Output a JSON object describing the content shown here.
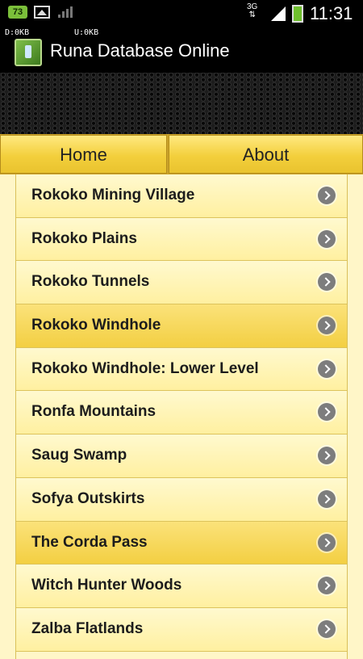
{
  "status_bar": {
    "notification_count": "73",
    "network_type": "3G",
    "time": "11:31",
    "icons": [
      "notification-badge-icon",
      "picture-icon",
      "wifi-bars-icon",
      "data-transfer-icon",
      "signal-icon",
      "battery-icon"
    ]
  },
  "app_bar": {
    "rx_label": "D:0KB",
    "tx_label": "U:0KB",
    "title": "Runa Database Online",
    "icon": "app-icon"
  },
  "nav": {
    "home_label": "Home",
    "about_label": "About"
  },
  "list": {
    "items": [
      {
        "label": "Rokoko Mining Village",
        "highlighted": false
      },
      {
        "label": "Rokoko Plains",
        "highlighted": false
      },
      {
        "label": "Rokoko Tunnels",
        "highlighted": false
      },
      {
        "label": "Rokoko Windhole",
        "highlighted": true
      },
      {
        "label": "Rokoko Windhole: Lower Level",
        "highlighted": false
      },
      {
        "label": "Ronfa Mountains",
        "highlighted": false
      },
      {
        "label": "Saug Swamp",
        "highlighted": false
      },
      {
        "label": "Sofya Outskirts",
        "highlighted": false
      },
      {
        "label": "The Corda Pass",
        "highlighted": true
      },
      {
        "label": "Witch Hunter Woods",
        "highlighted": false
      },
      {
        "label": "Zalba Flatlands",
        "highlighted": false
      }
    ]
  },
  "colors": {
    "accent_yellow": "#f3cf3c",
    "list_background": "#fff6c8",
    "highlight_row": "#f3cf42"
  }
}
